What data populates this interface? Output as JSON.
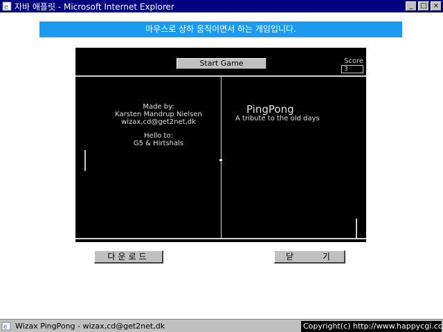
{
  "window": {
    "title": "자바 애플릿 - Microsoft Internet Explorer",
    "minimize_glyph": "_",
    "maximize_glyph": "□",
    "close_glyph": "×"
  },
  "banner": {
    "text": "마우스로 상하 움직이면서 하는 게임입니다.",
    "color": "#1a9bf0"
  },
  "game": {
    "start_button_label": "Start Game",
    "score_label": "Score",
    "score_value": "3",
    "credits": {
      "made_by_label": "Made by:",
      "author": "Karsten Mandrup Nielsen",
      "email": "wizax,cd@get2net,dk",
      "hello_label": "Hello to:",
      "hello_to": "G5 & Hirtshals"
    },
    "title": "PingPong",
    "subtitle": "A tribute to the old days"
  },
  "buttons": {
    "download_label": "다운로드",
    "close_label": "닫 기"
  },
  "statusbar": {
    "left_text": "Wizax PingPong - wizax,cd@get2net,dk",
    "right_text": "Copyright(c) http://www.happycgi.com"
  },
  "icons": {
    "title": "ie-page-icon",
    "status": "applet-icon"
  }
}
